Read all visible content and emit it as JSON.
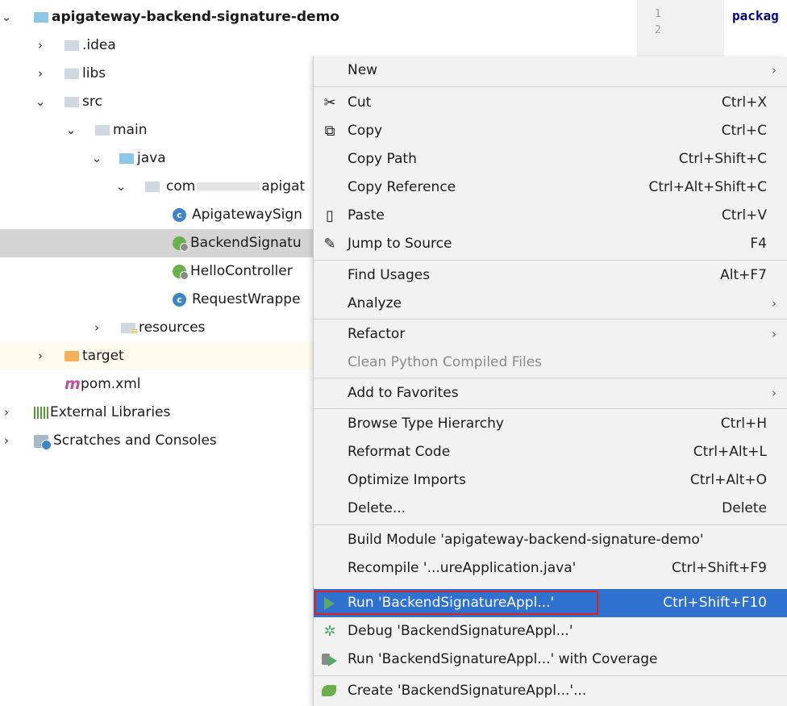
{
  "tree": {
    "project": "apigateway-backend-signature-demo",
    "idea": ".idea",
    "libs": "libs",
    "src": "src",
    "main": "main",
    "java": "java",
    "pkg_prefix": "com",
    "pkg_suffix": "apigat",
    "class1": "ApigatewaySign",
    "class2": "BackendSignatu",
    "class3": "HelloController",
    "class4": "RequestWrappe",
    "resources": "resources",
    "target": "target",
    "pom": "pom.xml",
    "pom_icon": "m",
    "ext_libs": "External Libraries",
    "scratches": "Scratches and Consoles",
    "class_glyph": "c"
  },
  "editor": {
    "line1": "1",
    "line2": "2",
    "code": "packag"
  },
  "menu": {
    "new": "New",
    "cut": "Cut",
    "cut_sc": "Ctrl+X",
    "copy": "Copy",
    "copy_sc": "Ctrl+C",
    "copy_path": "Copy Path",
    "copy_path_sc": "Ctrl+Shift+C",
    "copy_ref": "Copy Reference",
    "copy_ref_sc": "Ctrl+Alt+Shift+C",
    "paste": "Paste",
    "paste_sc": "Ctrl+V",
    "jump": "Jump to Source",
    "jump_sc": "F4",
    "find": "Find Usages",
    "find_sc": "Alt+F7",
    "analyze": "Analyze",
    "refactor": "Refactor",
    "clean": "Clean Python Compiled Files",
    "favorites": "Add to Favorites",
    "browse": "Browse Type Hierarchy",
    "browse_sc": "Ctrl+H",
    "reformat": "Reformat Code",
    "reformat_sc": "Ctrl+Alt+L",
    "optimize": "Optimize Imports",
    "optimize_sc": "Ctrl+Alt+O",
    "delete": "Delete...",
    "delete_sc": "Delete",
    "build": "Build Module 'apigateway-backend-signature-demo'",
    "recompile": "Recompile '...ureApplication.java'",
    "recompile_sc": "Ctrl+Shift+F9",
    "run": "Run 'BackendSignatureAppl...'",
    "run_sc": "Ctrl+Shift+F10",
    "debug": "Debug 'BackendSignatureAppl...'",
    "coverage": "Run 'BackendSignatureAppl...' with Coverage",
    "create": "Create 'BackendSignatureAppl...'...",
    "submenu_glyph": "›"
  },
  "colors": {
    "selection": "#2f71cf",
    "highlight_outline": "#e0201c",
    "run_green": "#59a869"
  }
}
